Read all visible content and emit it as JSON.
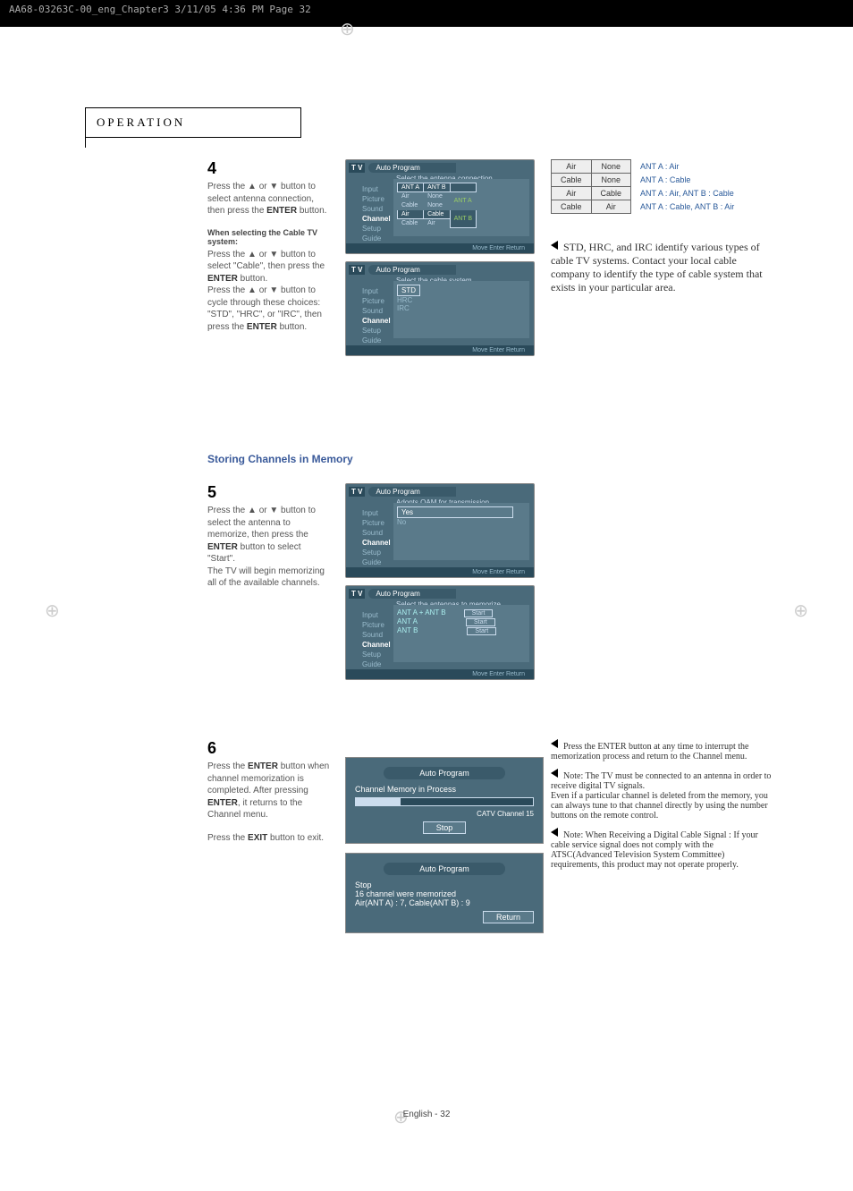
{
  "topbar": "AA68-03263C-00_eng_Chapter3  3/11/05  4:36 PM  Page 32",
  "section_title": "OPERATION",
  "footer": "English - 32",
  "step4": {
    "num": "4",
    "text1a": "Press the ▲ or ▼ button to select antenna connection, then press the ",
    "enter": "ENTER",
    "text1b": " button.",
    "subhdr": "When selecting the Cable TV system:",
    "text2": "Press the ▲ or ▼ button to select \"Cable\", then press the ",
    "text2b": " button.",
    "text3": "Press the ▲ or ▼ button to cycle through these choices: \"STD\", \"HRC\", or \"IRC\", then press the ",
    "text3b": " button."
  },
  "osd": {
    "tv": "T V",
    "auto_program": "Auto Program",
    "sel_ant": "Select the antenna connection",
    "sel_cable": "Select the cable system",
    "adopts_qam": "Adopts QAM for transmission",
    "sel_ant_mem": "Select the antennas to memorize",
    "nav": [
      "Input",
      "Picture",
      "Sound",
      "Channel",
      "Setup",
      "Guide"
    ],
    "ant_hdr": [
      "ANT A",
      "ANT B"
    ],
    "ant_rows": [
      [
        "Air",
        "None"
      ],
      [
        "Cable",
        "None"
      ],
      [
        "Air",
        "Cable"
      ],
      [
        "Cable",
        "Air"
      ]
    ],
    "badges": [
      "ANT A",
      "ANT B"
    ],
    "cable_rows": [
      "STD",
      "HRC",
      "IRC"
    ],
    "yes_no": [
      "Yes",
      "No"
    ],
    "mem_rows": [
      "ANT A + ANT B",
      "ANT A",
      "ANT B"
    ],
    "start": "Start",
    "foot": "Move      Enter      Return"
  },
  "ant_table": [
    {
      "a": "Air",
      "b": "None",
      "label": "ANT A : Air"
    },
    {
      "a": "Cable",
      "b": "None",
      "label": "ANT A : Cable"
    },
    {
      "a": "Air",
      "b": "Cable",
      "label": "ANT A : Air, ANT B : Cable"
    },
    {
      "a": "Cable",
      "b": "Air",
      "label": "ANT A : Cable, ANT B : Air"
    }
  ],
  "note4": "STD, HRC, and IRC identify various types of cable TV systems. Contact your local cable company to identify the type of cable system that exists in your particular area.",
  "storing_hdr": "Storing Channels in Memory",
  "step5": {
    "num": "5",
    "text": "Press the ▲ or ▼ button to select the antenna to memorize, then press the ",
    "enter": "ENTER",
    "text2": " button to select \"Start\".",
    "text3": "The TV will begin memorizing all of the available channels."
  },
  "step6": {
    "num": "6",
    "text1a": "Press the ",
    "enter": "ENTER",
    "text1b": " button when channel memorization is completed. After pressing ",
    "text1c": ", it returns to the Channel menu.",
    "text2a": "Press the ",
    "exit": "EXIT",
    "text2b": " button to exit."
  },
  "progress": {
    "title": "Auto Program",
    "line1": "Channel Memory in Process",
    "chan": "CATV Channel 15",
    "stop": "Stop",
    "done1": "Stop",
    "done2": "16 channel were memorized",
    "done3": "Air(ANT A) : 7, Cable(ANT B) : 9",
    "return": "Return"
  },
  "notes6": [
    "Press the ENTER button at any time to interrupt the memorization process and return to the Channel menu.",
    "Note: The TV must be connected to an antenna in order to receive digital TV signals.\nEven if a particular channel is deleted from the memory, you can always tune to that channel directly by using the number buttons on the remote control.",
    "Note: When Receiving a Digital Cable Signal : If your cable service signal does not comply with the ATSC(Advanced Television System Committee) requirements, this product may not operate properly."
  ]
}
